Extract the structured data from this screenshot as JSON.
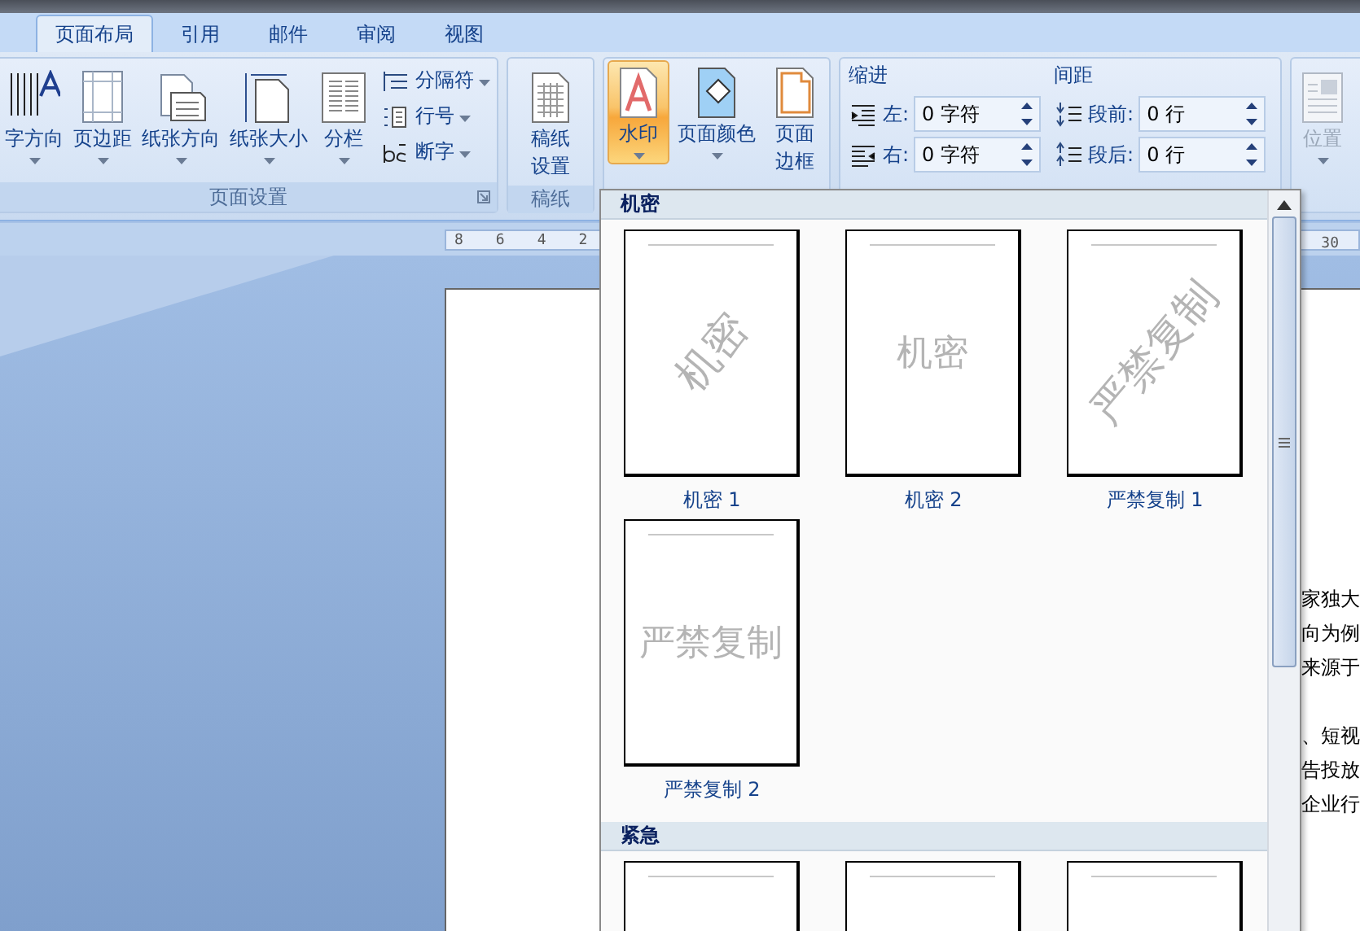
{
  "tabs": [
    {
      "label": "页面布局",
      "selected": true
    },
    {
      "label": "引用",
      "selected": false
    },
    {
      "label": "邮件",
      "selected": false
    },
    {
      "label": "审阅",
      "selected": false
    },
    {
      "label": "视图",
      "selected": false
    }
  ],
  "ribbon": {
    "page_setup": {
      "label": "页面设置",
      "big_buttons": [
        {
          "label": "字方向",
          "caret": true
        },
        {
          "label": "页边距",
          "caret": true
        },
        {
          "label": "纸张方向",
          "caret": true
        },
        {
          "label": "纸张大小",
          "caret": true
        },
        {
          "label": "分栏",
          "caret": true
        }
      ],
      "small_buttons": [
        {
          "label": "分隔符"
        },
        {
          "label": "行号"
        },
        {
          "label": "断字"
        }
      ]
    },
    "manuscript": {
      "label": "稿纸",
      "button": {
        "lines": [
          "稿纸",
          "设置"
        ]
      }
    },
    "background": {
      "buttons": [
        {
          "lines": [
            "水印"
          ],
          "caret": true,
          "pressed": true
        },
        {
          "lines": [
            "页面颜色"
          ],
          "caret": true,
          "pressed": false
        },
        {
          "lines": [
            "页面",
            "边框"
          ],
          "caret": false,
          "pressed": false
        }
      ]
    },
    "paragraph": {
      "indent": {
        "title": "缩进",
        "fields": [
          {
            "label": "左:",
            "value": "0 字符"
          },
          {
            "label": "右:",
            "value": "0 字符"
          }
        ]
      },
      "spacing": {
        "title": "间距",
        "fields": [
          {
            "label": "段前:",
            "value": "0 行"
          },
          {
            "label": "段后:",
            "value": "0 行"
          }
        ]
      }
    },
    "arrange": {
      "button": {
        "label": "位置",
        "disabled": true
      }
    }
  },
  "ruler": {
    "left_ticks": [
      "8",
      "6",
      "4",
      "2"
    ],
    "right_ticks": [
      "30"
    ]
  },
  "document": {
    "paragraphs": [
      [
        "家独大",
        "向为例",
        "来源于"
      ],
      [
        "、短视",
        "告投放",
        "企业行"
      ]
    ]
  },
  "watermark_menu": {
    "sections": [
      {
        "title": "机密",
        "items": [
          {
            "label": "机密 1",
            "watermark": "机密",
            "kind": "diagonal"
          },
          {
            "label": "机密 2",
            "watermark": "机密",
            "kind": "horizontal"
          },
          {
            "label": "严禁复制 1",
            "watermark": "严禁复制",
            "kind": "diagonal"
          },
          {
            "label": "严禁复制 2",
            "watermark": "严禁复制",
            "kind": "horizontal"
          }
        ]
      },
      {
        "title": "紧急",
        "items": [
          {
            "kind": "blank"
          },
          {
            "kind": "blank"
          },
          {
            "kind": "blank"
          }
        ]
      }
    ]
  }
}
